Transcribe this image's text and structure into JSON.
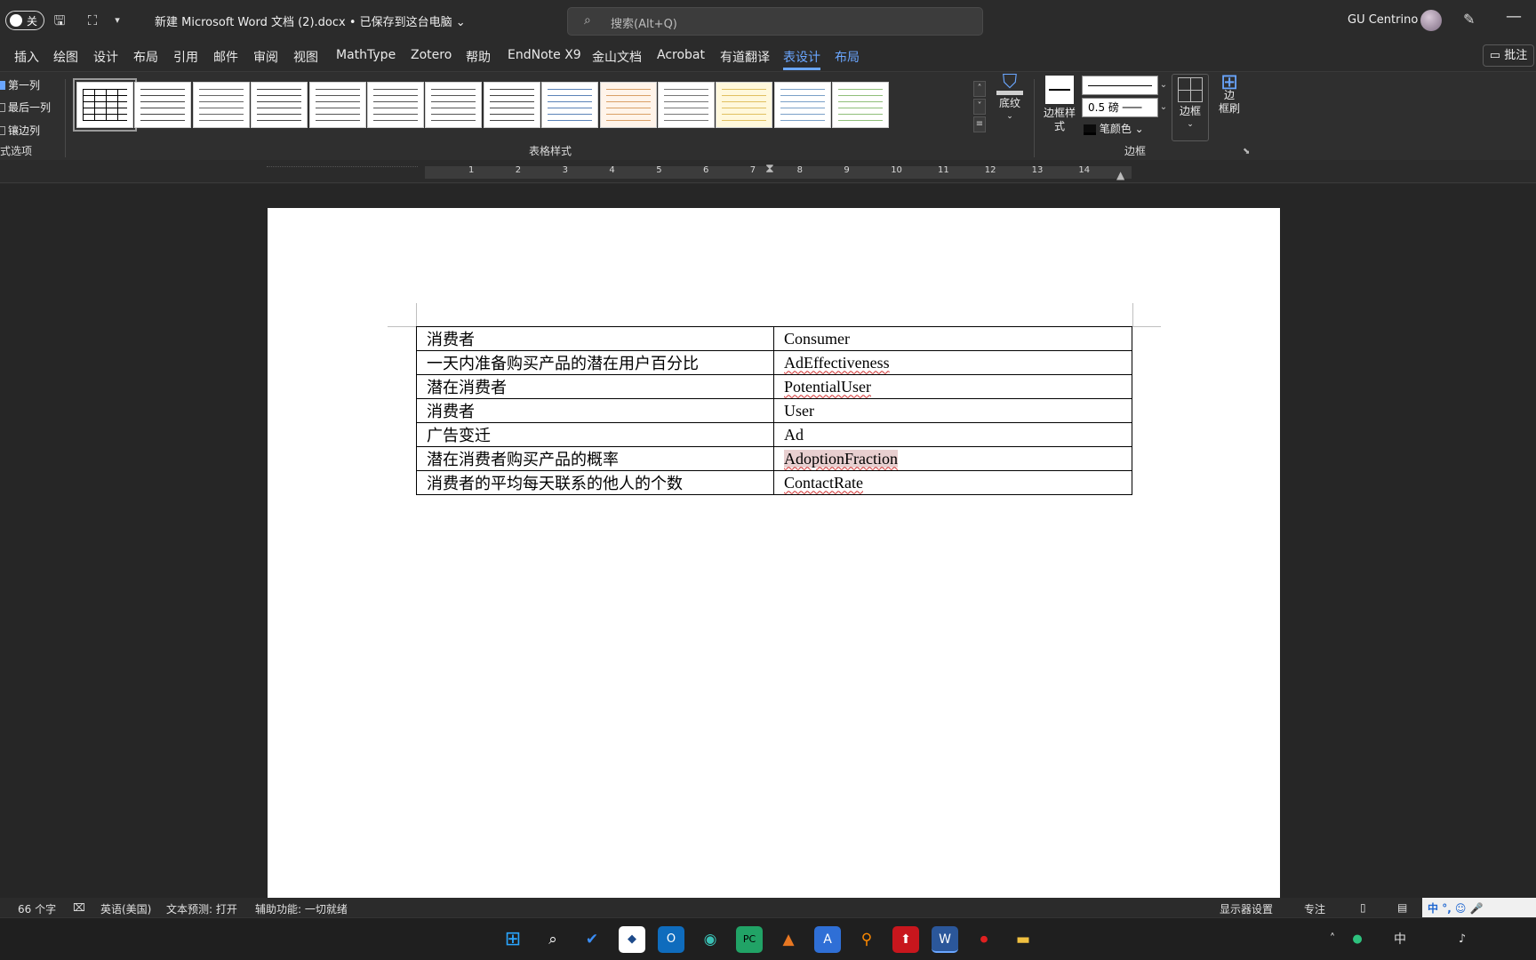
{
  "titlebar": {
    "autosave_label": "关",
    "doc_title": "新建 Microsoft Word 文档 (2).docx • 已保存到这台电脑 ⌄",
    "search_placeholder": "搜索(Alt+Q)",
    "user_name": "GU Centrino"
  },
  "tabs": [
    "插入",
    "绘图",
    "设计",
    "布局",
    "引用",
    "邮件",
    "审阅",
    "视图",
    "MathType",
    "Zotero",
    "帮助",
    "EndNote X9",
    "金山文档",
    "Acrobat",
    "有道翻译",
    "表设计",
    "布局"
  ],
  "comment_button": "批注",
  "ribbon": {
    "options": [
      "第一列",
      "最后一列",
      "镶边列"
    ],
    "options_group": "式选项",
    "styles_group": "表格样式",
    "shading": "底纹",
    "border_style": "边框样\n式",
    "line_weight": "0.5 磅",
    "pen_color": "笔颜色",
    "borders": "边框",
    "border_painter": "边\n框刷",
    "borders_group": "边框"
  },
  "ruler_numbers": [
    "1",
    "2",
    "3",
    "4",
    "5",
    "6",
    "7",
    "8",
    "9",
    "10",
    "11",
    "12",
    "13",
    "14"
  ],
  "table": {
    "rows": [
      {
        "zh": "消费者",
        "en": "Consumer",
        "squiggle": false,
        "highlight": false
      },
      {
        "zh": "一天内准备购买产品的潜在用户百分比",
        "en": "AdEffectiveness",
        "squiggle": true,
        "highlight": false
      },
      {
        "zh": "潜在消费者",
        "en": "PotentialUser",
        "squiggle": true,
        "highlight": false
      },
      {
        "zh": "消费者",
        "en": "User",
        "squiggle": false,
        "highlight": false
      },
      {
        "zh": "广告变迁",
        "en": "Ad",
        "squiggle": false,
        "highlight": false
      },
      {
        "zh": "潜在消费者购买产品的概率",
        "en": "AdoptionFraction",
        "squiggle": true,
        "highlight": true
      },
      {
        "zh": "消费者的平均每天联系的他人的个数",
        "en": "ContactRate",
        "squiggle": true,
        "highlight": false
      }
    ]
  },
  "status": {
    "word_count": "66 个字",
    "language": "英语(美国)",
    "predict": "文本预测: 打开",
    "accessibility": "辅助功能: 一切就绪",
    "display_settings": "显示器设置",
    "focus": "专注",
    "ime": "中"
  },
  "colors": {
    "accent": "#6aa6ff",
    "page": "#ffffff",
    "squiggle": "#d03030"
  }
}
